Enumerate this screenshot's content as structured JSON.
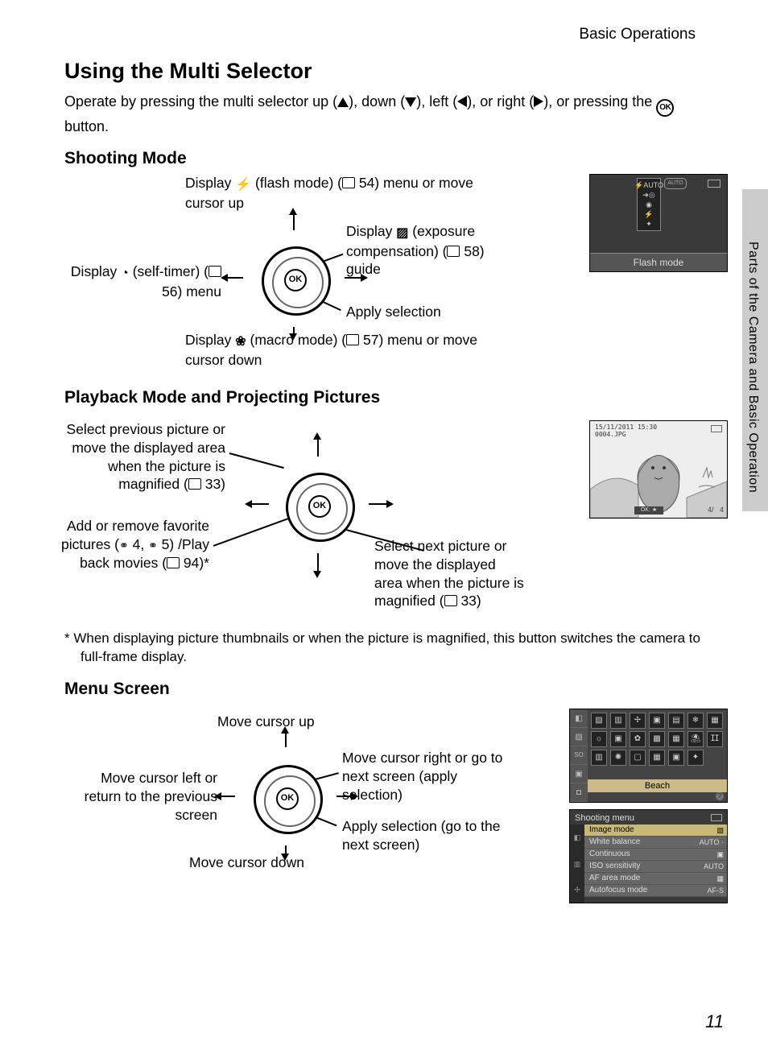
{
  "breadcrumb": "Basic Operations",
  "side_tab": "Parts of the Camera and Basic Operation",
  "page_number": "11",
  "h1": "Using the Multi Selector",
  "intro": {
    "pre": "Operate by pressing the multi selector up (",
    "mid1": "), down (",
    "mid2": "), left (",
    "mid3": "), or right (",
    "mid4": "), or pressing the ",
    "ok": "OK",
    "post": " button."
  },
  "shoot": {
    "h2": "Shooting Mode",
    "up_a": "Display ",
    "up_b": " (flash mode) (",
    "up_c": " 54) menu or move cursor up",
    "left_a": "Display ",
    "left_b": " (self-timer) (",
    "left_c": " 56) menu",
    "right_a": "Display ",
    "right_b": " (exposure compensation) (",
    "right_c": " 58) guide",
    "ok": "Apply selection",
    "down_a": "Display ",
    "down_b": " (macro mode) (",
    "down_c": " 57) menu or move cursor down",
    "screen_label": "Flash mode",
    "screen_badge": "AUTO"
  },
  "play": {
    "h2": "Playback Mode and Projecting Pictures",
    "up_a": "Select previous picture or move the displayed area when the picture is magnified (",
    "up_b": " 33)",
    "left_a": "Add or remove favorite pictures (",
    "left_b": " 4, ",
    "left_c": " 5) /Play back movies (",
    "left_d": " 94)*",
    "right_a": "Select next picture or move the displayed area when the picture is magnified (",
    "right_b": " 33)",
    "screen": {
      "ts_line1": "15/11/2011 15:30",
      "ts_line2": "0004.JPG",
      "ok": "OK",
      "br1": "4/",
      "br2": "4"
    }
  },
  "footnote": "*   When displaying picture thumbnails or when the picture is magnified, this button switches the camera to full-frame display.",
  "menu": {
    "h2": "Menu Screen",
    "up": "Move cursor up",
    "left": "Move cursor left or return to the previous screen",
    "right": "Move cursor right or go to next screen (apply selection)",
    "ok": "Apply selection (go to the next screen)",
    "down": "Move cursor down",
    "scene_label": "Beach",
    "shooting_menu": {
      "title": "Shooting menu",
      "items": [
        {
          "name": "Image mode",
          "val": "▧"
        },
        {
          "name": "White balance",
          "val": "AUTO ·"
        },
        {
          "name": "Continuous",
          "val": "▣"
        },
        {
          "name": "ISO sensitivity",
          "val": "AUTO"
        },
        {
          "name": "AF area mode",
          "val": "▦"
        },
        {
          "name": "Autofocus mode",
          "val": "AF-S"
        }
      ]
    }
  }
}
